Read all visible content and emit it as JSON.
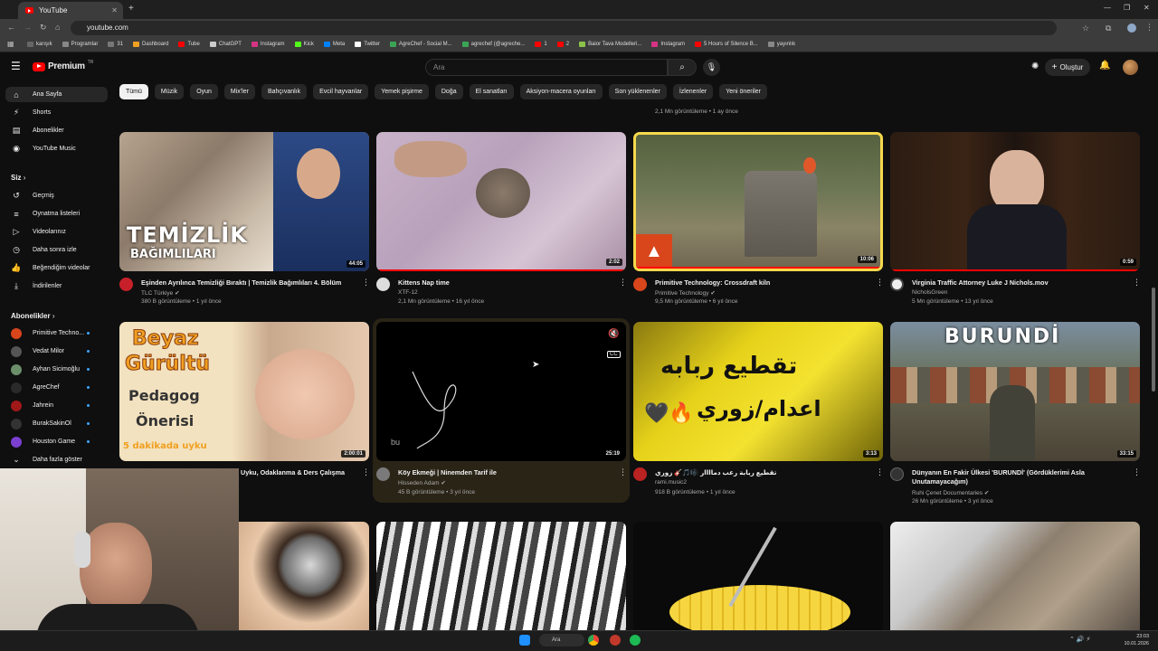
{
  "browser": {
    "tab_title": "YouTube",
    "url": "youtube.com",
    "bookmarks": [
      "karışık",
      "Programlar",
      "31",
      "Dashboard",
      "Tube",
      "ChatGPT",
      "Instagram",
      "Kick",
      "Meta",
      "Twitter",
      "AgreChef - Social M...",
      "agrechef (@agreche...",
      "1",
      "2",
      "Baior Tava Modelleri...",
      "Instagram",
      "5 Hours of Silence B...",
      "yayınlık"
    ]
  },
  "header": {
    "logo": "Premium",
    "logo_sup": "TR",
    "search_placeholder": "Ara",
    "create_label": "Oluştur"
  },
  "chips": [
    "Tümü",
    "Müzik",
    "Oyun",
    "Mix'ler",
    "Bahçıvanlık",
    "Evcil hayvanlar",
    "Yemek pişirme",
    "Doğa",
    "El sanatları",
    "Aksiyon-macera oyunları",
    "Son yüklenenler",
    "İzlenenler",
    "Yeni öneriler"
  ],
  "sidebar": {
    "main": [
      "Ana Sayfa",
      "Shorts",
      "Abonelikler",
      "YouTube Music"
    ],
    "you_title": "Siz",
    "you": [
      "Geçmiş",
      "Oynatma listeleri",
      "Videolarınız",
      "Daha sonra izle",
      "Beğendiğim videolar",
      "İndirilenler"
    ],
    "subs_title": "Abonelikler",
    "subs": [
      "Primitive Techno...",
      "Vedat Milor",
      "Ayhan Sicimoğlu",
      "AgreChef",
      "Jahrein",
      "BurakSakinOl",
      "Houston Game"
    ],
    "more": "Daha fazla göster"
  },
  "top_meta": "2,1 Mn görüntüleme • 1 ay önce",
  "videos": [
    {
      "title": "Eşinden Ayrılınca Temizliği Bıraktı | Temizlik Bağımlıları 4. Bölüm",
      "channel": "TLC Türkiye",
      "meta": "380 B görüntüleme • 1 yıl önce",
      "duration": "44:05",
      "overlay": "TEMİZLİK",
      "overlay2": "BAĞIMLILARI"
    },
    {
      "title": "Kittens Nap time",
      "channel": "XTF-12",
      "meta": "2,1 Mn görüntüleme • 16 yıl önce",
      "duration": "2:02",
      "progress": 1.0
    },
    {
      "title": "Primitive Technology: Crossdraft kiln",
      "channel": "Primitive Technology",
      "meta": "9,5 Mn görüntüleme • 6 yıl önce",
      "duration": "10:06",
      "progress": 1.0
    },
    {
      "title": "Virginia Traffic Attorney Luke J Nichols.mov",
      "channel": "NicholsGreen",
      "meta": "5 Mn görüntüleme • 13 yıl önce",
      "duration": "0:59",
      "progress": 1.0
    },
    {
      "title": "Uyku, Odaklanma & Ders Çalışma",
      "channel": "",
      "meta": "",
      "duration": "2:00:01",
      "overlay": "Beyaz",
      "overlay2": "Gürültü",
      "overlay3": "Pedagog",
      "overlay4": "Önerisi",
      "overlay5": "5 dakikada uyku"
    },
    {
      "title": "Köy Ekmeği | Ninemden Tarif ile",
      "channel": "Hisseden Adam",
      "meta": "45 B görüntüleme • 3 yıl önce",
      "duration": "25:19",
      "overlay": "bu"
    },
    {
      "title": "تقطيع ربابة رعب دماااار 🎼🎵🎸 زوري",
      "channel": "rami.music2",
      "meta": "918 B görüntüleme • 1 yıl önce",
      "duration": "3:13",
      "overlay": "تقطيع ربابه",
      "overlay2": "اعدام/زوري"
    },
    {
      "title": "Dünyanın En Fakir Ülkesi 'BURUNDİ' (Gördüklerimi Asla Unutamayacağım)",
      "title2": "Unutamayacağım)",
      "channel": "Ruhi Çenet Documentaries",
      "meta": "26 Mn görüntüleme • 3 yıl önce",
      "duration": "33:15",
      "overlay": "BURUNDİ"
    }
  ],
  "taskbar": {
    "search": "Ara",
    "time": "23:03",
    "date": "10.01.2026"
  },
  "colors": {
    "accent": "#ff0000",
    "chip_active": "#f1f1f1",
    "link_blue": "#3ea6ff"
  }
}
